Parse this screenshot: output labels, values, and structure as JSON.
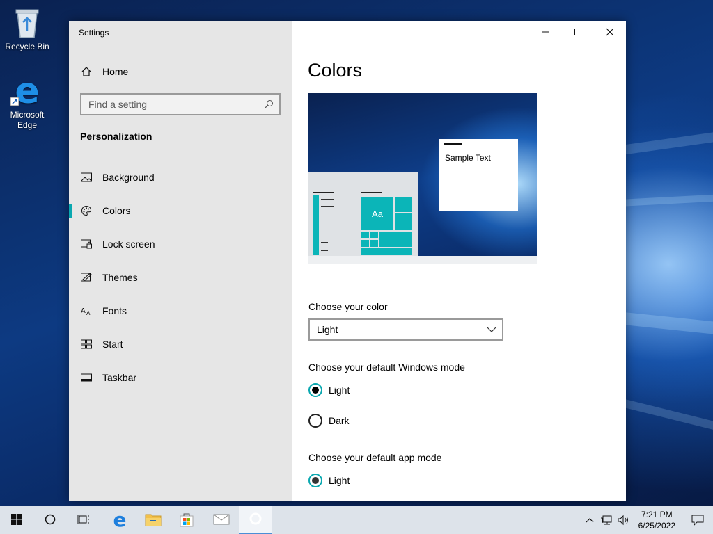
{
  "desktop": {
    "icons": [
      {
        "label": "Recycle Bin"
      },
      {
        "label": "Microsoft Edge"
      }
    ]
  },
  "window": {
    "title": "Settings",
    "nav": {
      "home_label": "Home",
      "search_placeholder": "Find a setting",
      "section_heading": "Personalization",
      "items": [
        {
          "label": "Background",
          "icon": "picture-icon"
        },
        {
          "label": "Colors",
          "icon": "palette-icon",
          "selected": true
        },
        {
          "label": "Lock screen",
          "icon": "lock-screen-icon"
        },
        {
          "label": "Themes",
          "icon": "themes-icon"
        },
        {
          "label": "Fonts",
          "icon": "fonts-icon"
        },
        {
          "label": "Start",
          "icon": "start-icon"
        },
        {
          "label": "Taskbar",
          "icon": "taskbar-icon"
        }
      ]
    },
    "content": {
      "page_title": "Colors",
      "preview": {
        "sample_text": "Sample Text",
        "tile_text": "Aa"
      },
      "choose_color": {
        "label": "Choose your color",
        "selected": "Light"
      },
      "windows_mode": {
        "label": "Choose your default Windows mode",
        "options": [
          "Light",
          "Dark"
        ],
        "selected": "Light"
      },
      "app_mode": {
        "label": "Choose your default app mode",
        "options": [
          "Light"
        ],
        "selected": "Light"
      }
    },
    "accent_color": "#0aa8b0"
  },
  "taskbar": {
    "clock_time": "7:21 PM",
    "clock_date": "6/25/2022"
  }
}
